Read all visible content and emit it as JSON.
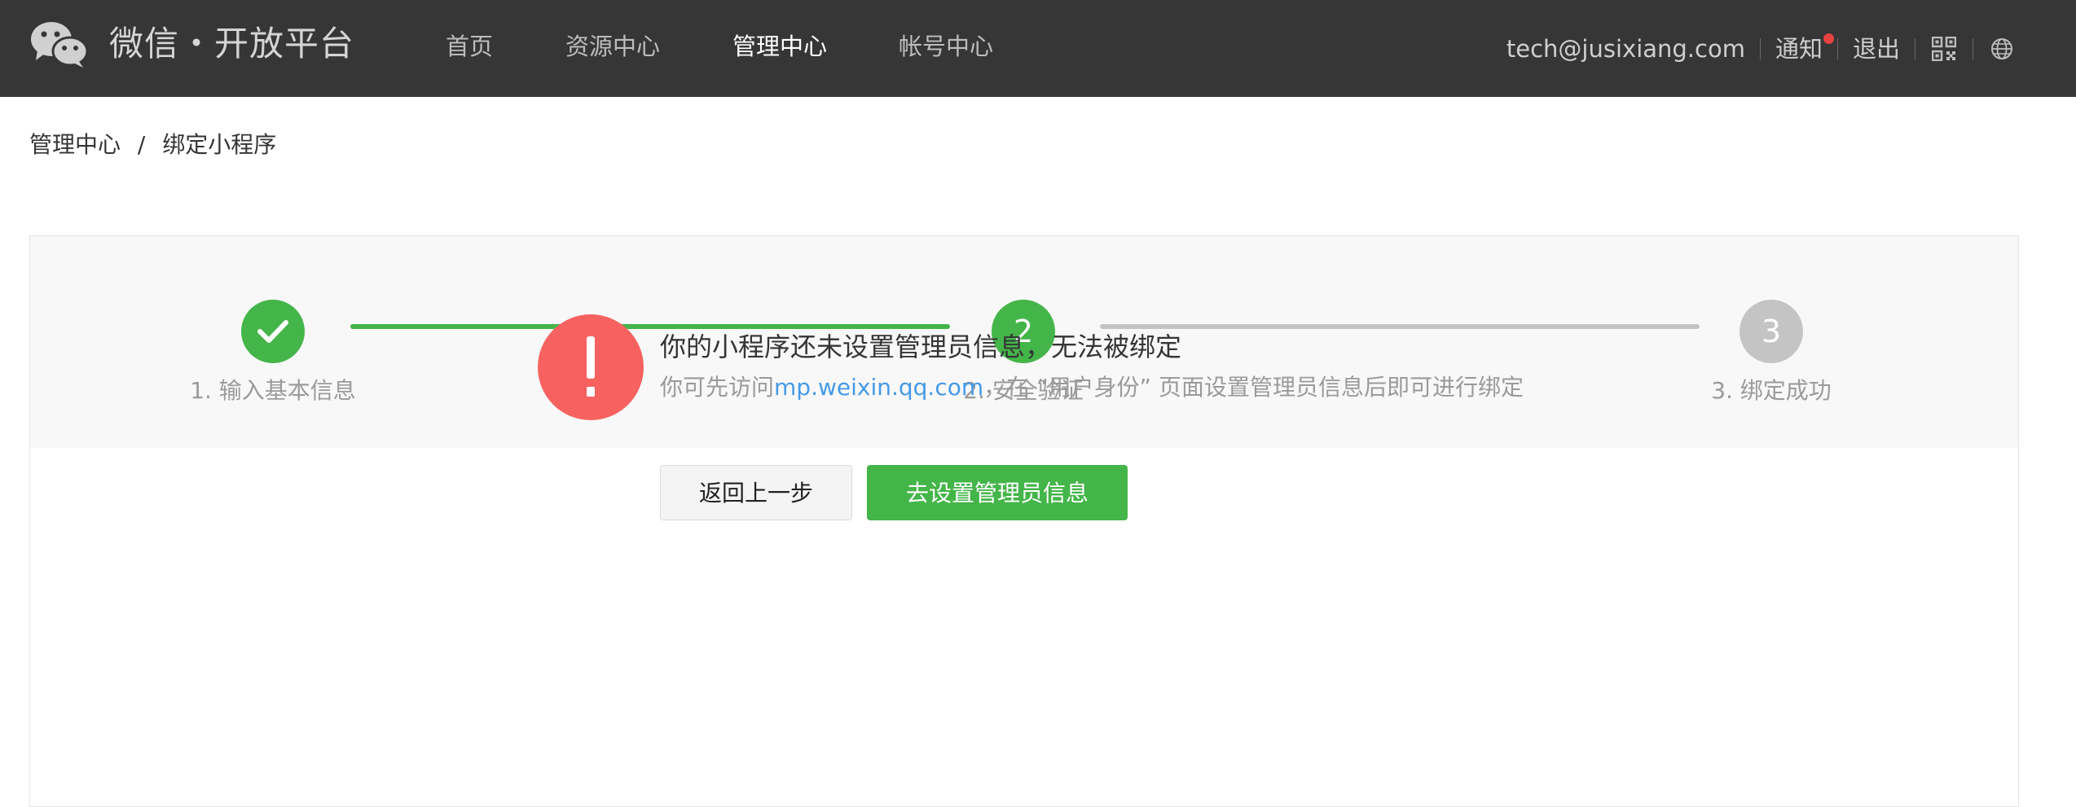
{
  "header": {
    "brand": "微信・开放平台",
    "nav": [
      {
        "label": "首页"
      },
      {
        "label": "资源中心"
      },
      {
        "label": "管理中心"
      },
      {
        "label": "帐号中心"
      }
    ],
    "account_email": "tech@jusixiang.com",
    "notify_label": "通知",
    "logout_label": "退出",
    "icons": [
      "qrcode-icon",
      "globe-icon"
    ]
  },
  "breadcrumb": {
    "parent": "管理中心",
    "separator": "/",
    "current": "绑定小程序"
  },
  "steps": {
    "items": [
      {
        "label": "1. 输入基本信息",
        "status": "done"
      },
      {
        "label": "2. 安全验证",
        "number": "2",
        "status": "current"
      },
      {
        "label": "3. 绑定成功",
        "number": "3",
        "status": "pending"
      }
    ]
  },
  "message": {
    "title": "你的小程序还未设置管理员信息，无法被绑定",
    "desc_prefix": "你可先访问",
    "link": "mp.weixin.qq.com",
    "desc_suffix": "，在 “用户身份” 页面设置管理员信息后即可进行绑定"
  },
  "buttons": {
    "back": "返回上一步",
    "setup": "去设置管理员信息"
  },
  "colors": {
    "topbar": "#363636",
    "green": "#44b549",
    "gray_step": "#c4c4c4",
    "warn": "#f76260",
    "link": "#459ae9",
    "notify_dot": "#e64340"
  }
}
